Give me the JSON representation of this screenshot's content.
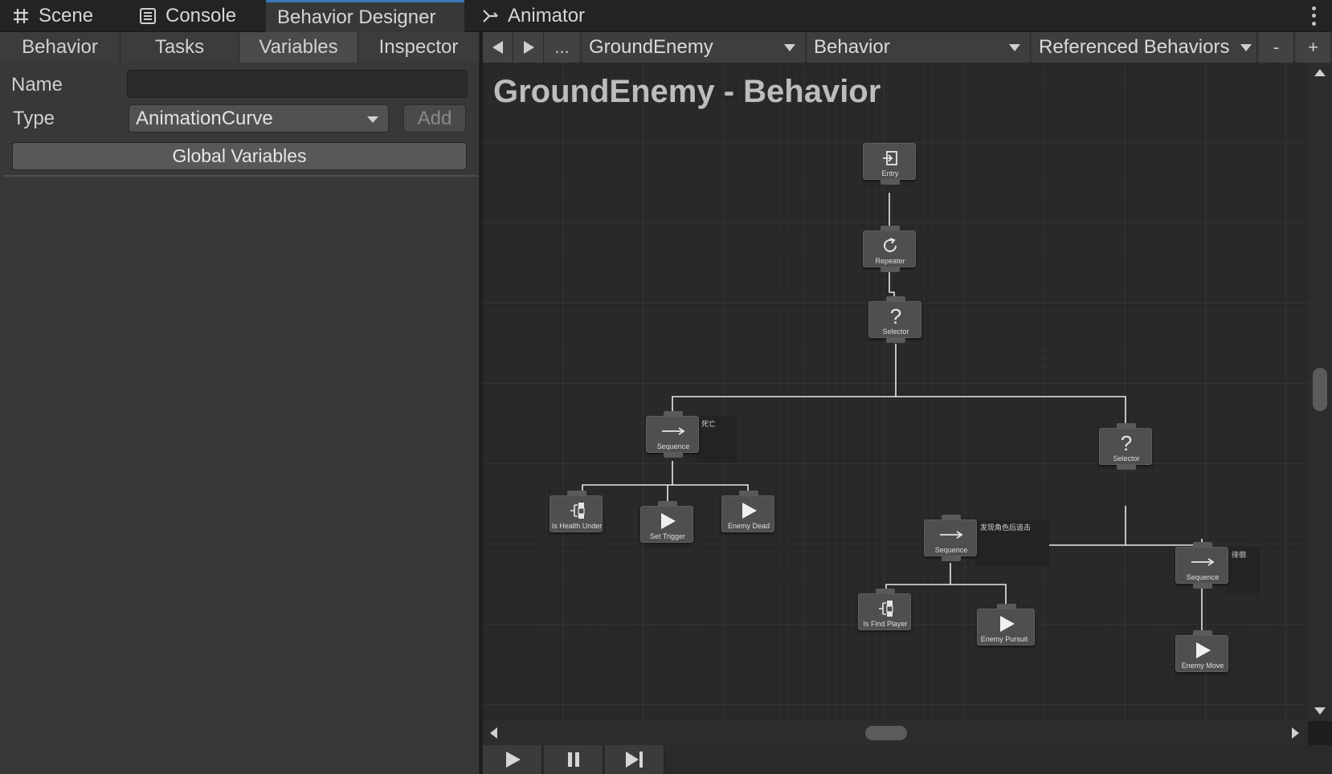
{
  "dock_tabs": [
    {
      "label": "Scene",
      "icon": "grid-hash-icon"
    },
    {
      "label": "Console",
      "icon": "console-list-icon"
    },
    {
      "label": "Behavior Designer",
      "icon": ""
    },
    {
      "label": "Animator",
      "icon": "animator-branch-icon"
    }
  ],
  "left_panel": {
    "tabs": [
      "Behavior",
      "Tasks",
      "Variables",
      "Inspector"
    ],
    "active_tab": "Variables",
    "name_label": "Name",
    "name_value": "",
    "type_label": "Type",
    "type_value": "AnimationCurve",
    "add_label": "Add",
    "global_variables_label": "Global Variables"
  },
  "toolbar": {
    "more_label": "...",
    "object_dropdown": "GroundEnemy",
    "behavior_dropdown": "Behavior",
    "referenced_dropdown": "Referenced Behaviors",
    "minus_label": "-",
    "plus_label": "+"
  },
  "graph": {
    "title": "GroundEnemy - Behavior",
    "nodes": [
      {
        "id": "entry",
        "label": "Entry",
        "icon": "entry-icon"
      },
      {
        "id": "repeater",
        "label": "Repeater",
        "icon": "repeat-icon"
      },
      {
        "id": "selector1",
        "label": "Selector",
        "icon": "question-icon"
      },
      {
        "id": "sequence1",
        "label": "Sequence",
        "icon": "arrow-right-icon",
        "comment": "死亡"
      },
      {
        "id": "selector2",
        "label": "Selector",
        "icon": "question-icon"
      },
      {
        "id": "health",
        "label": "Is Health Under",
        "icon": "conditional-icon"
      },
      {
        "id": "trigger",
        "label": "Set Trigger",
        "icon": "play-icon"
      },
      {
        "id": "dead",
        "label": "Enemy Dead",
        "icon": "play-icon"
      },
      {
        "id": "sequence2",
        "label": "Sequence",
        "icon": "arrow-right-icon",
        "comment": "发现角色后追击"
      },
      {
        "id": "sequence3",
        "label": "Sequence",
        "icon": "arrow-right-icon",
        "comment": "徘徊"
      },
      {
        "id": "findplayer",
        "label": "Is Find Player",
        "icon": "conditional-icon"
      },
      {
        "id": "pursuit",
        "label": "Enemy Pursuit",
        "icon": "play-icon"
      },
      {
        "id": "move",
        "label": "Enemy Move",
        "icon": "play-icon"
      }
    ]
  },
  "controls": [
    "play-icon",
    "pause-icon",
    "step-icon"
  ],
  "colors": {
    "accent": "#3a79bb",
    "panel": "#383838",
    "canvas": "#282828"
  }
}
